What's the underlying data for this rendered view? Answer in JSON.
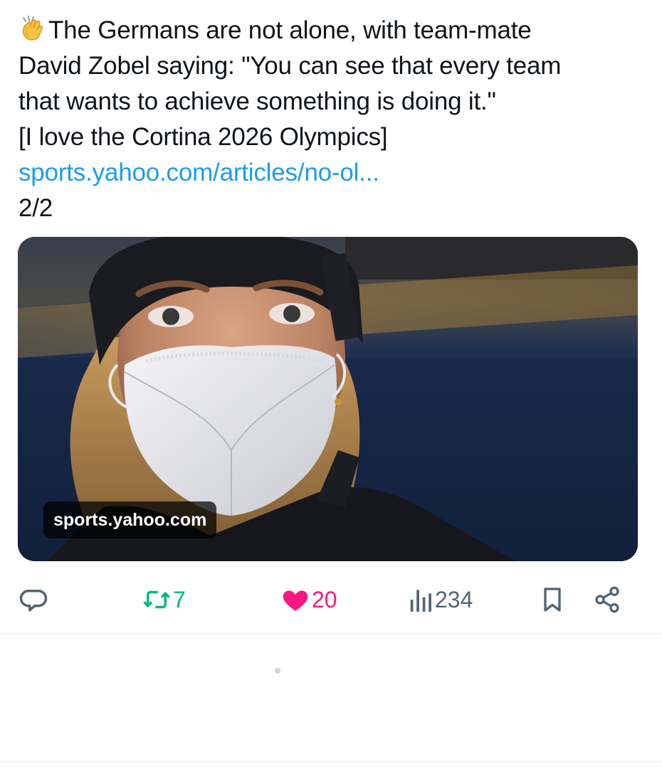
{
  "tweet": {
    "emoji": "clapping-hands",
    "lines": [
      "The Germans are not alone, with team-mate",
      "David Zobel saying: \"You can see that every team",
      "that wants to achieve something is doing it.\"",
      "[I love the Cortina 2026 Olympics]"
    ],
    "link_text": "sports.yahoo.com/articles/no-ol...",
    "thread_position": "2/2"
  },
  "media": {
    "domain": "sports.yahoo.com"
  },
  "actions": {
    "reply": {
      "icon": "reply-icon",
      "count": ""
    },
    "retweet": {
      "icon": "retweet-icon",
      "count": "7",
      "color": "#00ba7c"
    },
    "like": {
      "icon": "heart-icon",
      "count": "20",
      "color": "#f91880"
    },
    "views": {
      "icon": "views-icon",
      "count": "234",
      "color": "#536471"
    },
    "bookmark": {
      "icon": "bookmark-icon"
    },
    "share": {
      "icon": "share-icon"
    }
  },
  "colors": {
    "text": "#0f1419",
    "link": "#1d9bf0",
    "muted": "#536471",
    "divider": "#e6ecf0"
  }
}
